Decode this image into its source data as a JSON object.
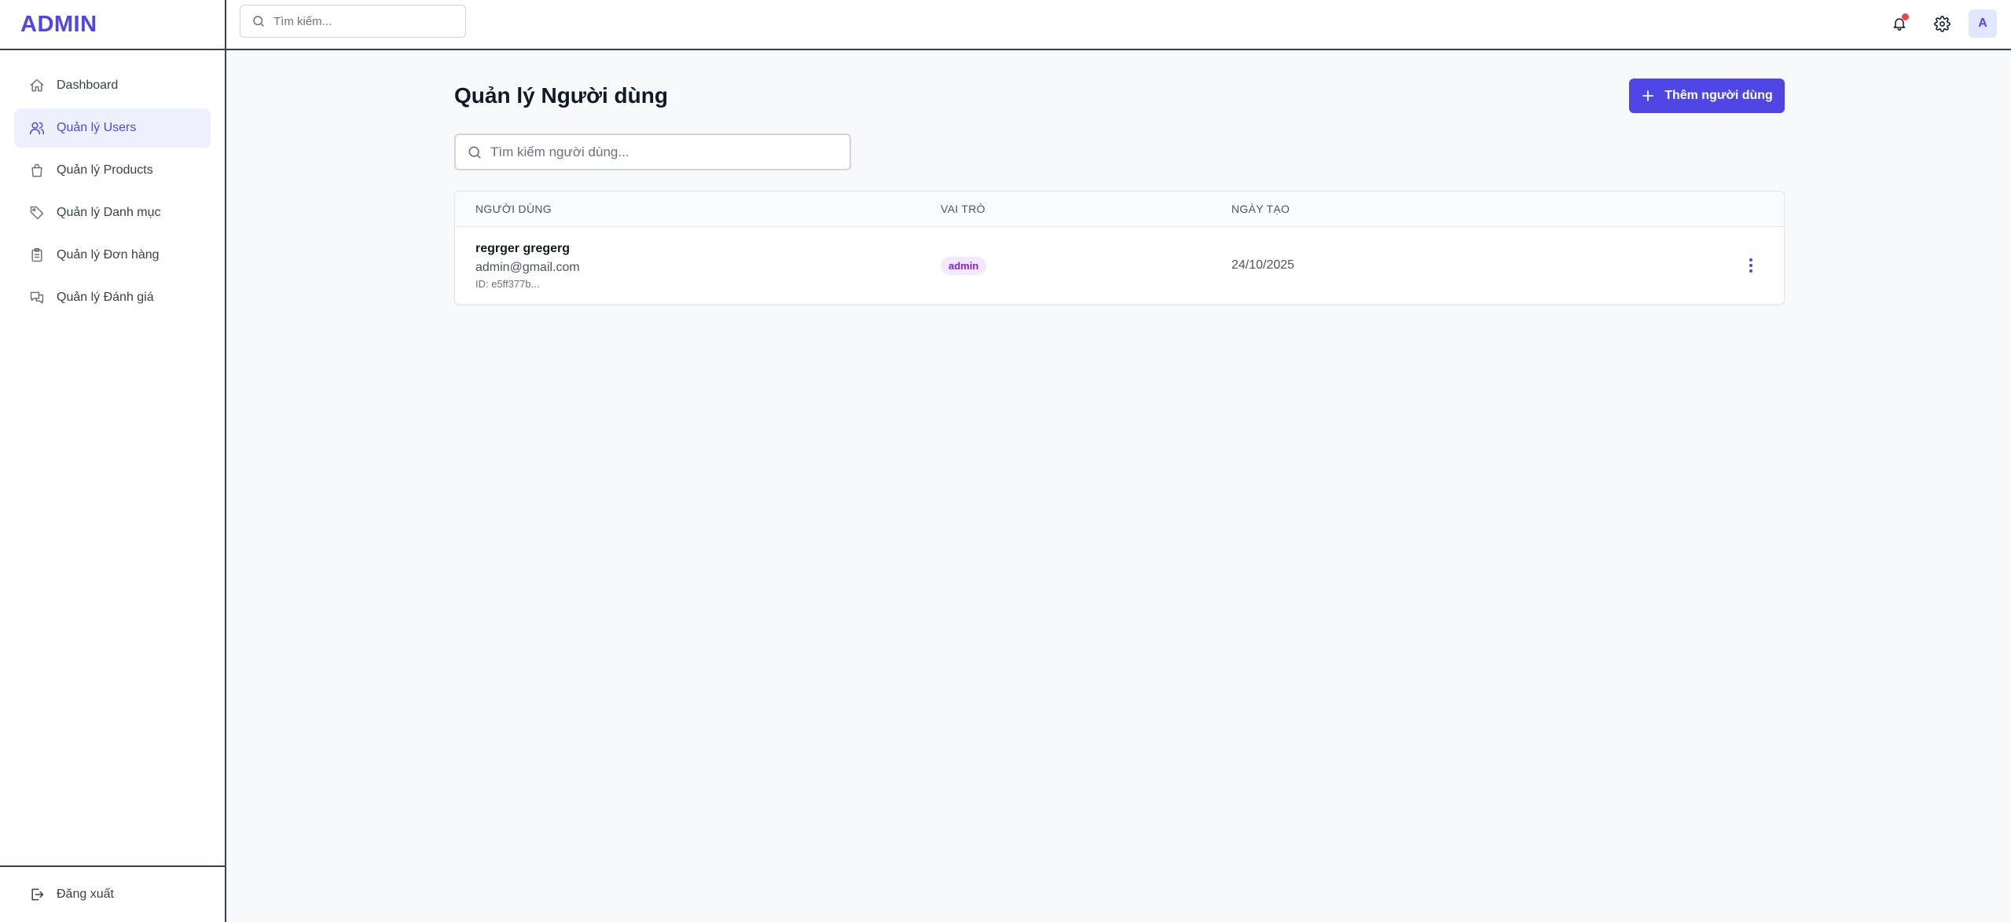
{
  "brand": {
    "title": "ADMIN",
    "color": "#4f46e5"
  },
  "sidebar": {
    "items": [
      {
        "label": "Dashboard",
        "icon": "home-icon",
        "active": false
      },
      {
        "label": "Quản lý Users",
        "icon": "users-icon",
        "active": true
      },
      {
        "label": "Quản lý Products",
        "icon": "shopping-bag-icon",
        "active": false
      },
      {
        "label": "Quản lý Danh mục",
        "icon": "tag-icon",
        "active": false
      },
      {
        "label": "Quản lý Đơn hàng",
        "icon": "clipboard-icon",
        "active": false
      },
      {
        "label": "Quản lý Đánh giá",
        "icon": "chat-bubbles-icon",
        "active": false
      }
    ],
    "logout_label": "Đăng xuất"
  },
  "topbar": {
    "search_placeholder": "Tìm kiếm...",
    "avatar_initial": "A",
    "notification_dot_color": "#ef4444"
  },
  "main": {
    "title": "Quản lý Người dùng",
    "add_button_label": "Thêm người dùng",
    "search_placeholder": "Tìm kiếm người dùng...",
    "table": {
      "headers": [
        "NGƯỜI DÙNG",
        "VAI TRÒ",
        "NGÀY TẠO"
      ],
      "rows": [
        {
          "name": "regrger gregerg",
          "email": "admin@gmail.com",
          "id": "ID: e5ff377b...",
          "role": "admin",
          "created": "24/10/2025"
        }
      ]
    }
  },
  "colors": {
    "accent": "#4f46e5",
    "active_bg": "#eef0fe",
    "role_badge_bg": "#f3e8ff",
    "role_badge_text": "#7e22ce"
  }
}
